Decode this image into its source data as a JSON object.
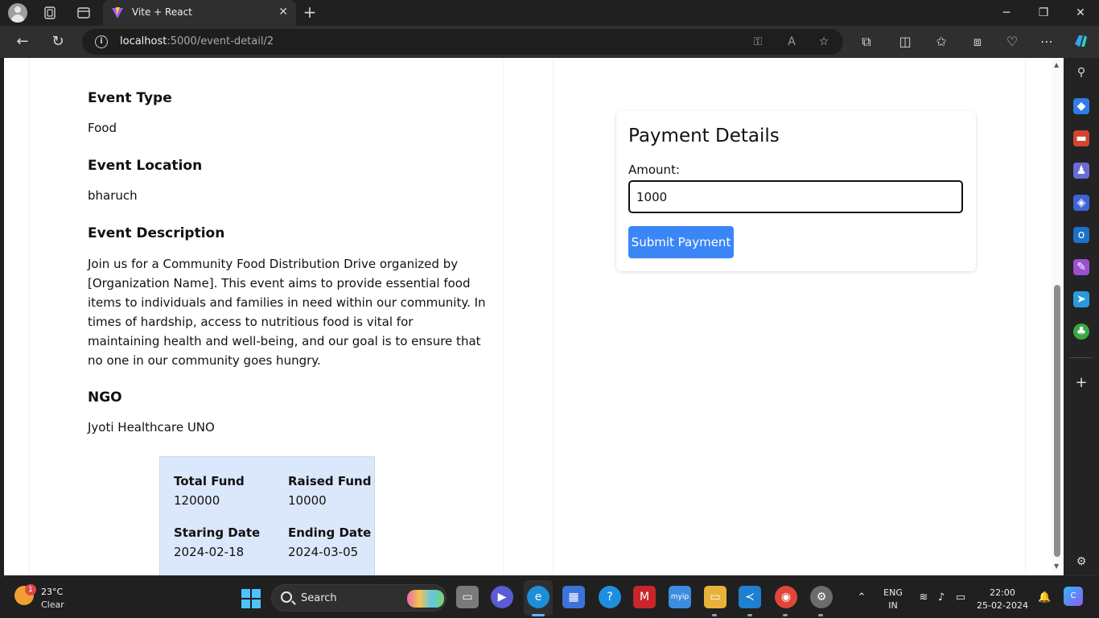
{
  "browser": {
    "tab_title": "Vite + React",
    "url_host": "localhost",
    "url_rest": ":5000/event-detail/2"
  },
  "event": {
    "type_label": "Event Type",
    "type_value": "Food",
    "location_label": "Event Location",
    "location_value": "bharuch",
    "description_label": "Event Description",
    "description_value": "Join us for a Community Food Distribution Drive organized by [Organization Name]. This event aims to provide essential food items to individuals and families in need within our community. In times of hardship, access to nutritious food is vital for maintaining health and well-being, and our goal is to ensure that no one in our community goes hungry.",
    "ngo_label": "NGO",
    "ngo_value": "Jyoti Healthcare UNO"
  },
  "fund": {
    "total_label": "Total Fund",
    "total_value": "120000",
    "raised_label": "Raised Fund",
    "raised_value": "10000",
    "start_label": "Staring Date",
    "start_value": "2024-02-18",
    "end_label": "Ending Date",
    "end_value": "2024-03-05"
  },
  "payment": {
    "title": "Payment Details",
    "amount_label": "Amount:",
    "amount_value": "1000",
    "submit_label": "Submit Payment"
  },
  "taskbar": {
    "weather_temp": "23°C",
    "weather_cond": "Clear",
    "weather_badge": "1",
    "search_label": "Search",
    "lang_line1": "ENG",
    "lang_line2": "IN",
    "time": "22:00",
    "date": "25-02-2024"
  },
  "colors": {
    "accent_button": "#3b86f7",
    "fund_box_bg": "#dbe8fb"
  }
}
